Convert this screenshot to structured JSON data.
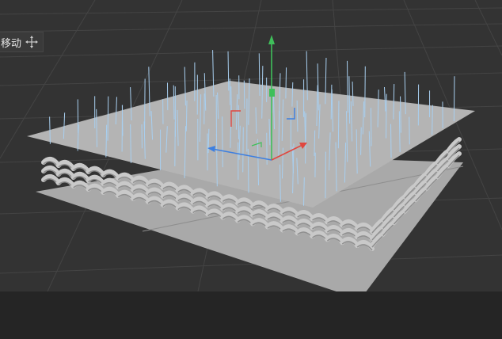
{
  "viewport": {
    "tool_label": "移动",
    "tool_icon": "move-icon",
    "gizmo_icon": "transform-gizmo-icon",
    "colors": {
      "background": "#333333",
      "grid": "#454545",
      "plane": "#aaaaaa",
      "mesh": "#c8c8c8",
      "hair": "#a8cff0",
      "axis_x": "#e0473f",
      "axis_y": "#3fbf5a",
      "axis_z": "#3d7fe0"
    }
  }
}
